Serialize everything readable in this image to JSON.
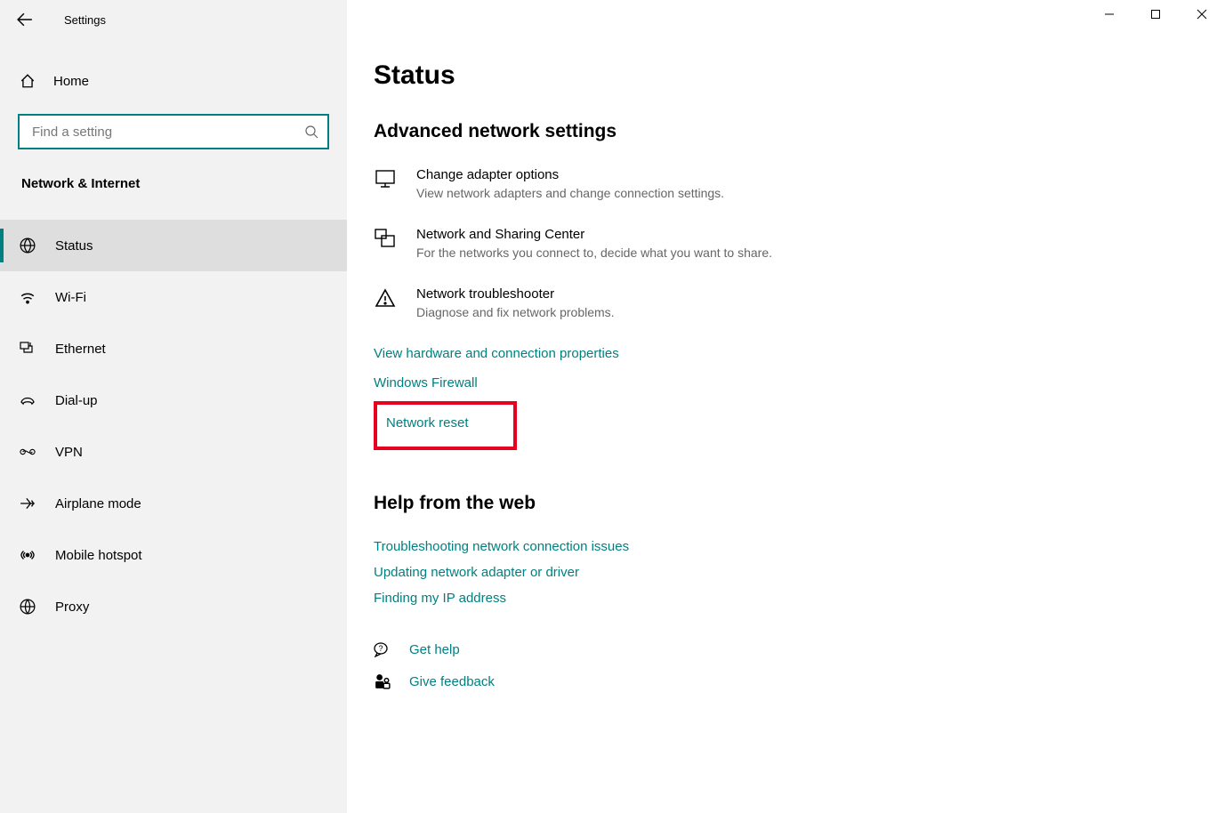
{
  "window": {
    "title": "Settings"
  },
  "home_label": "Home",
  "search": {
    "placeholder": "Find a setting"
  },
  "group_title": "Network & Internet",
  "nav": {
    "items": [
      {
        "label": "Status",
        "icon": "globe",
        "active": true
      },
      {
        "label": "Wi-Fi",
        "icon": "wifi",
        "active": false
      },
      {
        "label": "Ethernet",
        "icon": "ethernet",
        "active": false
      },
      {
        "label": "Dial-up",
        "icon": "dialup",
        "active": false
      },
      {
        "label": "VPN",
        "icon": "vpn",
        "active": false
      },
      {
        "label": "Airplane mode",
        "icon": "airplane",
        "active": false
      },
      {
        "label": "Mobile hotspot",
        "icon": "hotspot",
        "active": false
      },
      {
        "label": "Proxy",
        "icon": "proxy",
        "active": false
      }
    ]
  },
  "page": {
    "title": "Status",
    "section": "Advanced network settings",
    "options": [
      {
        "title": "Change adapter options",
        "desc": "View network adapters and change connection settings.",
        "icon": "adapter"
      },
      {
        "title": "Network and Sharing Center",
        "desc": "For the networks you connect to, decide what you want to share.",
        "icon": "sharing"
      },
      {
        "title": "Network troubleshooter",
        "desc": "Diagnose and fix network problems.",
        "icon": "warning"
      }
    ],
    "links": [
      "View hardware and connection properties",
      "Windows Firewall"
    ],
    "highlighted_link": "Network reset",
    "help_heading": "Help from the web",
    "help_links": [
      "Troubleshooting network connection issues",
      "Updating network adapter or driver",
      "Finding my IP address"
    ],
    "bottom": {
      "get_help": "Get help",
      "give_feedback": "Give feedback"
    }
  }
}
